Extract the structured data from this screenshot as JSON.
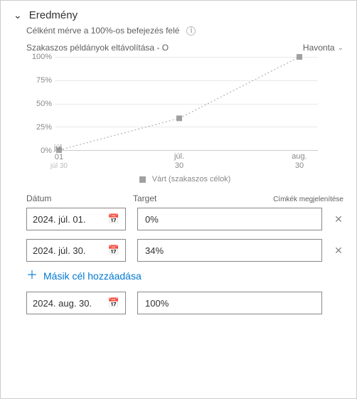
{
  "header": {
    "title": "Eredmény",
    "subtitle": "Célként mérve a 100%-os befejezés felé"
  },
  "chart_header": {
    "series_label": "Szakaszos példányok eltávolítása - O",
    "frequency": "Havonta"
  },
  "chart_data": {
    "type": "line",
    "x_labels": [
      {
        "month": "júl.",
        "day": "01",
        "note": "júl 30"
      },
      {
        "month": "júl.",
        "day": "30"
      },
      {
        "month": "aug.",
        "day": "30"
      }
    ],
    "values": [
      0,
      34,
      100
    ],
    "ylim": [
      0,
      100
    ],
    "yticks": [
      0,
      25,
      50,
      75,
      100
    ],
    "legend": "Várt (szakaszos célok)"
  },
  "columns": {
    "date": "Dátum",
    "target": "Target",
    "labels_link": "Címkék megjelenítése"
  },
  "goals": [
    {
      "date": "2024. júl. 01.",
      "target": "0%",
      "removable": true
    },
    {
      "date": "2024. júl. 30.",
      "target": "34%",
      "removable": true
    }
  ],
  "add_goal_label": "Másik cél hozzáadása",
  "final_goal": {
    "date": "2024. aug. 30.",
    "target": "100%"
  }
}
